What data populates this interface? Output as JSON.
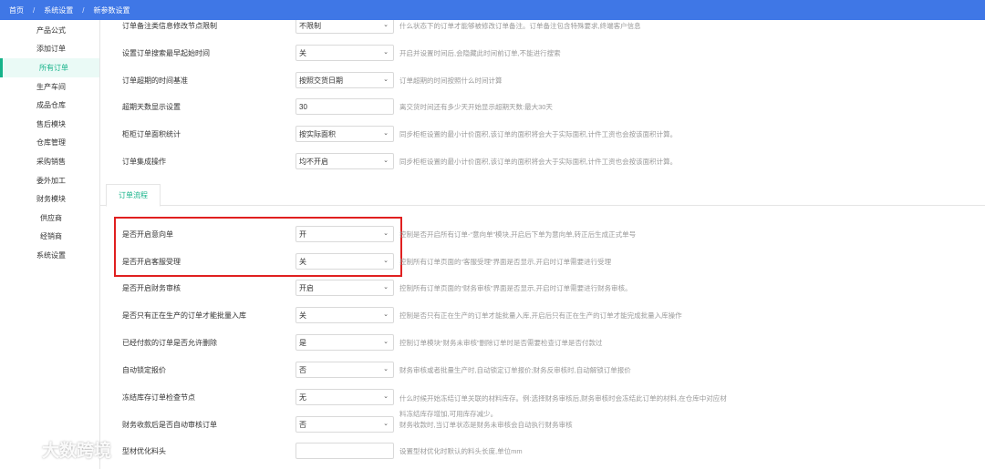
{
  "breadcrumb": {
    "home": "首页",
    "settings": "系统设置",
    "current": "新参数设置"
  },
  "sidebar": {
    "items": [
      {
        "label": "产品公式"
      },
      {
        "label": "添加订单"
      },
      {
        "label": "所有订单"
      },
      {
        "label": "生产车间"
      },
      {
        "label": "成品仓库"
      },
      {
        "label": "售后模块"
      },
      {
        "label": "仓库管理"
      },
      {
        "label": "采购销售"
      },
      {
        "label": "委外加工"
      },
      {
        "label": "财务模块"
      },
      {
        "label": "供应商"
      },
      {
        "label": "经销商"
      },
      {
        "label": "系统设置"
      }
    ],
    "active_index": 2
  },
  "settings_top": [
    {
      "label": "订单备注类信息修改节点限制",
      "value": "不限制",
      "desc": "什么状态下的订单才能够被修改订单备注。订单备注包含特殊要求,终端客户信息"
    },
    {
      "label": "设置订单搜索最早起始时间",
      "value": "关",
      "desc": "开启并设置时间后,会隐藏此时间前订单,不能进行搜索"
    },
    {
      "label": "订单超期的时间基准",
      "value": "按照交货日期",
      "desc": "订单超期的时间按照什么时间计算"
    },
    {
      "label": "超期天数显示设置",
      "value": "30",
      "desc": "离交货时间还有多少天开始显示超期天数:最大30天"
    },
    {
      "label": "柜柜订单面积统计",
      "value": "按实际面积",
      "desc": "同步柜柜设置的最小计价面积,该订单的面积将会大于实际面积,计件工资也会按该面积计算。"
    },
    {
      "label": "订单集成操作",
      "value": "均不开启",
      "desc": "同步柜柜设置的最小计价面积,该订单的面积将会大于实际面积,计件工资也会按该面积计算。"
    }
  ],
  "tab": {
    "label": "订单流程"
  },
  "settings_flow": [
    {
      "label": "是否开启意向单",
      "value": "开",
      "desc": "控制是否开启所有订单-“意向单”模块,开启后下单为意向单,转正后生成正式单号"
    },
    {
      "label": "是否开启客服受理",
      "value": "关",
      "desc": "控制所有订单页面的“客服受理”界面是否显示,开启时订单需要进行受理"
    },
    {
      "label": "是否开启财务审核",
      "value": "开启",
      "desc": "控制所有订单页面的“财务审核”界面是否显示,开启时订单需要进行财务审核。"
    },
    {
      "label": "是否只有正在生产的订单才能批量入库",
      "value": "关",
      "desc": "控制是否只有正在生产的订单才能批量入库,开启后只有正在生产的订单才能完成批量入库操作"
    },
    {
      "label": "已经付款的订单是否允许删除",
      "value": "是",
      "desc": "控制订单模块“财务未审核”删除订单时是否需要检查订单是否付款过"
    },
    {
      "label": "自动锁定报价",
      "value": "否",
      "desc": "财务审核或者批量生产时,自动锁定订单报价;财务反审核时,自动解锁订单报价"
    },
    {
      "label": "冻结库存订单检查节点",
      "value": "无",
      "desc": "什么时候开始冻结订单关联的材料库存。例:选择财务审核后,财务审核时会冻结此订单的材料,在仓库中对应材",
      "desc2": "料冻结库存增加,可用库存减少。"
    },
    {
      "label": "财务收款后是否自动审核订单",
      "value": "否",
      "desc": "财务收款时,当订单状态是财务未审核会自动执行财务审核"
    },
    {
      "label": "型材优化料头",
      "value": "",
      "desc": "设置型材优化时默认的料头长度,单位mm"
    }
  ],
  "watermark": {
    "text": "大数跨境"
  },
  "colors": {
    "topbar": "#3f77e6",
    "accent": "#16b38a",
    "highlight": "#e02020"
  }
}
